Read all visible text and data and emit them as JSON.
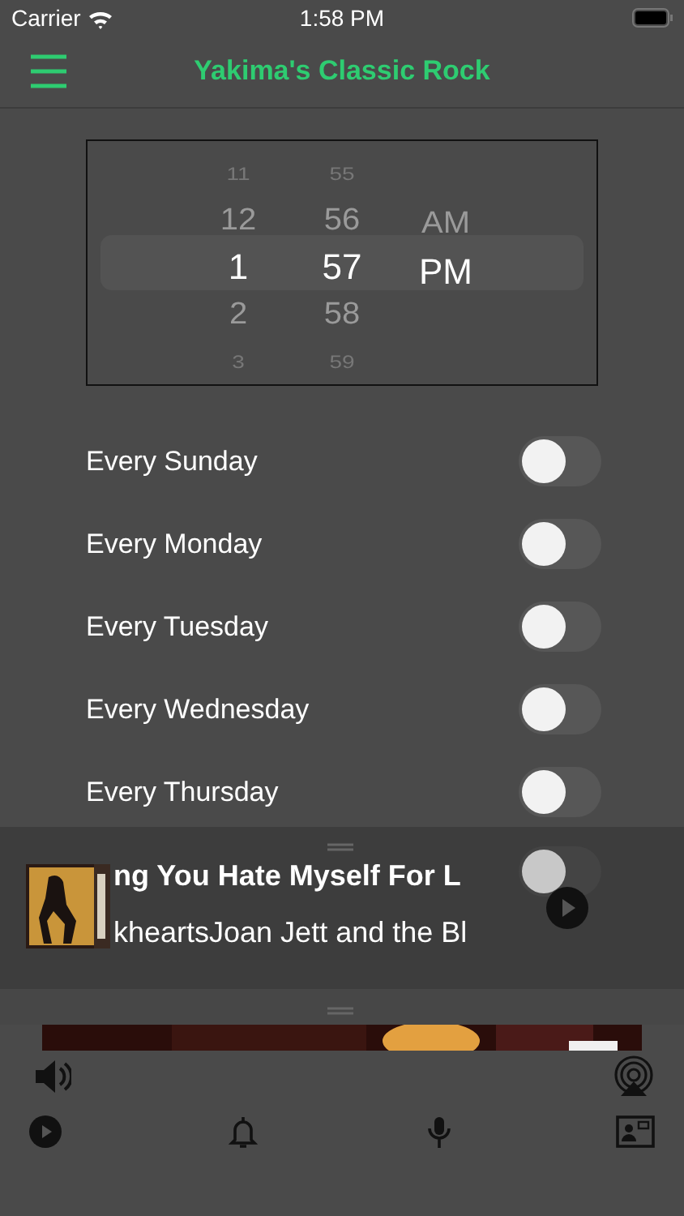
{
  "status_bar": {
    "carrier": "Carrier",
    "time": "1:58 PM"
  },
  "nav": {
    "title": "Yakima's Classic Rock"
  },
  "time_picker": {
    "columns": [
      {
        "items": [
          {
            "label": "11",
            "selected": false
          },
          {
            "label": "12",
            "selected": false
          },
          {
            "label": "1",
            "selected": true
          },
          {
            "label": "2",
            "selected": false
          },
          {
            "label": "3",
            "selected": false
          }
        ]
      },
      {
        "items": [
          {
            "label": "55",
            "selected": false
          },
          {
            "label": "56",
            "selected": false
          },
          {
            "label": "57",
            "selected": true
          },
          {
            "label": "58",
            "selected": false
          },
          {
            "label": "59",
            "selected": false
          }
        ]
      },
      {
        "items": [
          {
            "label": "AM",
            "selected": false
          },
          {
            "label": "PM",
            "selected": true
          }
        ]
      }
    ]
  },
  "days": [
    {
      "label": "Every Sunday",
      "on": false
    },
    {
      "label": "Every Monday",
      "on": false
    },
    {
      "label": "Every Tuesday",
      "on": false
    },
    {
      "label": "Every Wednesday",
      "on": false
    },
    {
      "label": "Every Thursday",
      "on": false
    }
  ],
  "friday_toggle": {
    "on": false
  },
  "now_playing": {
    "title": "ng You Hate Myself For L",
    "artist": "kheartsJoan Jett and the Bl"
  }
}
